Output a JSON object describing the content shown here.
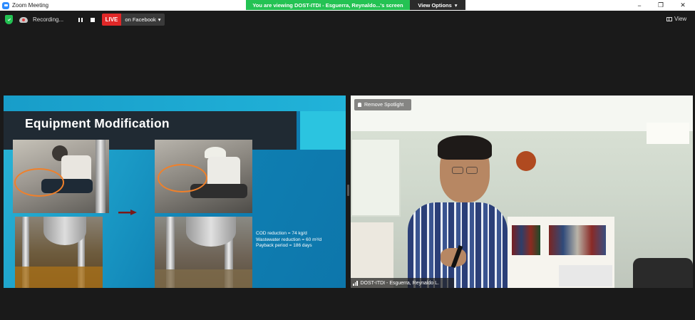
{
  "window": {
    "title": "Zoom Meeting",
    "min_glyph": "−",
    "max_glyph": "❐",
    "close_glyph": "✕"
  },
  "share_banner": {
    "text": "You are viewing DOST-ITDI - Esguerra, Reynaldo...'s screen",
    "options_label": "View Options",
    "options_caret": "▾"
  },
  "toolbar": {
    "recording_label": "Recording...",
    "live_label": "LIVE",
    "live_dest_label": "on Facebook",
    "live_dest_caret": "▾",
    "view_label": "View"
  },
  "slide": {
    "title": "Equipment Modification",
    "stats": [
      "COD reduction = 74 kg/d",
      "Wastewater reduction = 60 m³/d",
      "Payback period = 186 days"
    ]
  },
  "video": {
    "spotlight_label": "Remove Spotlight",
    "participant_name": "DOST-ITDI - Esguerra, Reynaldo L."
  },
  "colors": {
    "accent_green": "#24c253",
    "live_red": "#e02828",
    "ring_orange": "#f0802a"
  }
}
